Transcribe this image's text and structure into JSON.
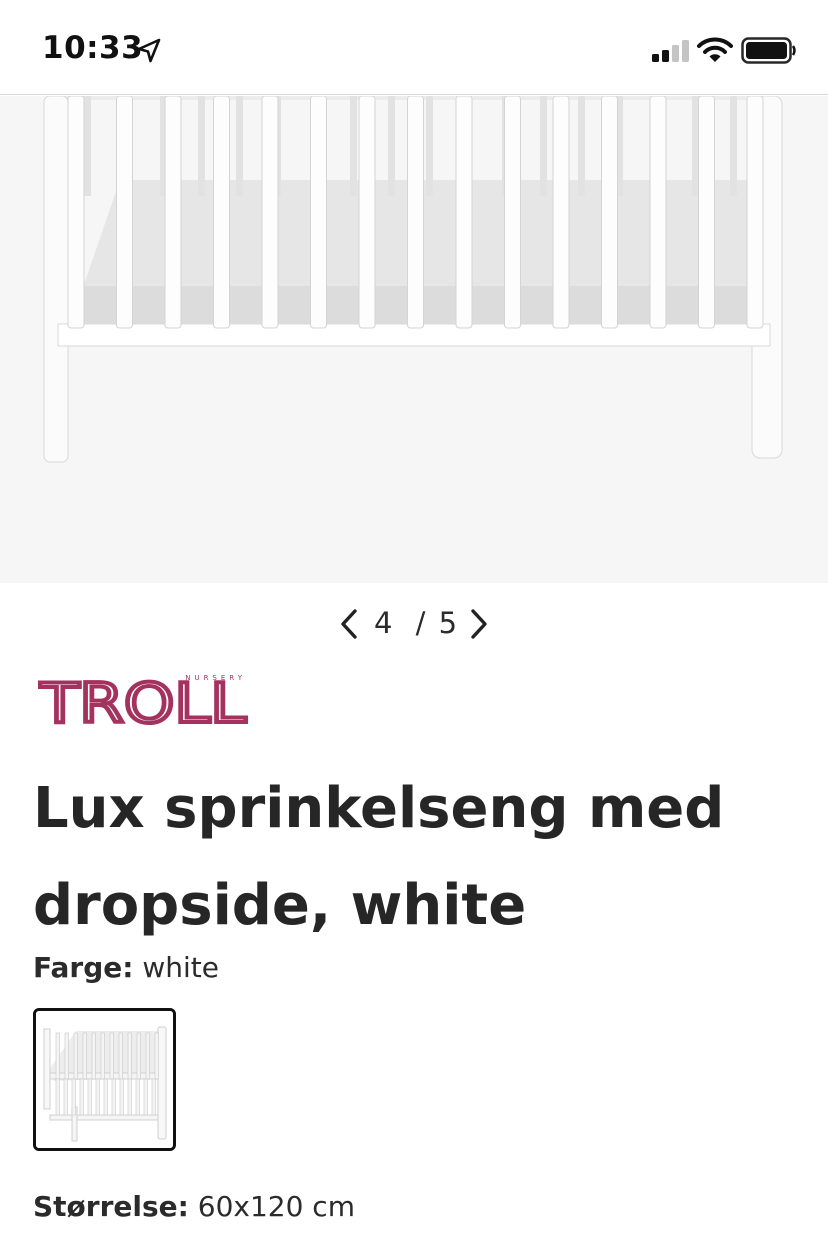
{
  "status_bar": {
    "time": "10:33"
  },
  "gallery": {
    "current": "4",
    "separator": "/",
    "total": "5"
  },
  "brand": {
    "name": "TROLL",
    "tagline": "NURSERY",
    "color": "#a4325f"
  },
  "product": {
    "title": "Lux sprinkelseng med dropside, white",
    "color_label": "Farge:",
    "color_value": "white",
    "size_label": "Størrelse:",
    "size_value": "60x120 cm"
  },
  "icons": [
    "location-arrow-icon",
    "cellular-signal-icon",
    "wifi-icon",
    "battery-icon",
    "chevron-left-icon",
    "chevron-right-icon"
  ]
}
